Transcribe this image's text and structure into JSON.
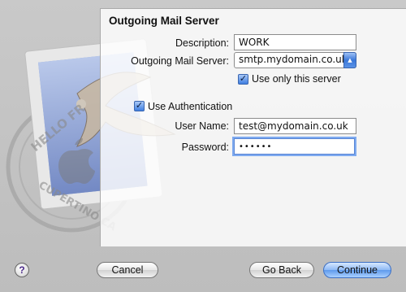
{
  "window": {
    "section_title": "Outgoing Mail Server"
  },
  "form": {
    "description": {
      "label": "Description:",
      "value": "WORK"
    },
    "outgoing_server": {
      "label": "Outgoing Mail Server:",
      "value": "smtp.mydomain.co.uk"
    },
    "use_only_this_server": {
      "label": "Use only this server",
      "checked": true
    },
    "use_authentication": {
      "label": "Use Authentication",
      "checked": true
    },
    "user_name": {
      "label": "User Name:",
      "value": "test@mydomain.co.uk"
    },
    "password": {
      "label": "Password:",
      "value": "••••••"
    }
  },
  "buttons": {
    "help": "?",
    "cancel": "Cancel",
    "go_back": "Go Back",
    "continue": "Continue"
  },
  "stamp": {
    "text_top": "HELLO FR",
    "text_bottom": "CUPERTINO CA"
  },
  "colors": {
    "accent": "#3b78d8",
    "help_glyph": "#4b2a8a"
  }
}
